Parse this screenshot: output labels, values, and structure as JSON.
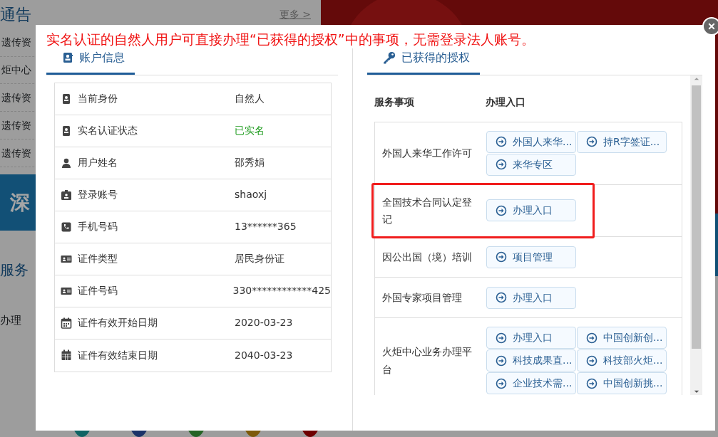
{
  "background": {
    "section_title": "通告",
    "more_link": "更多 >",
    "list_items": [
      "遗传资",
      "炬中心",
      "遗传资",
      "遗传资",
      "遗传资"
    ],
    "banner_text": "深",
    "service_title": "服务",
    "service_item": "办理"
  },
  "dialog": {
    "notice": "实名认证的自然人用户可直接办理“已获得的授权”中的事项，无需登录法人账号。",
    "account_tab": {
      "label": "账户信息",
      "selected": true
    },
    "account_rows": [
      {
        "kind": "id",
        "label": "当前身份",
        "value": "自然人"
      },
      {
        "kind": "id",
        "label": "实名认证状态",
        "value": "已实名",
        "verified": true
      },
      {
        "kind": "user",
        "label": "用户姓名",
        "value": "邵秀娟"
      },
      {
        "kind": "badge",
        "label": "登录账号",
        "value": "shaoxj"
      },
      {
        "kind": "phone",
        "label": "手机号码",
        "value": "13******365"
      },
      {
        "kind": "card",
        "label": "证件类型",
        "value": "居民身份证"
      },
      {
        "kind": "card",
        "label": "证件号码",
        "value": "330************425"
      },
      {
        "kind": "calendar",
        "label": "证件有效开始日期",
        "value": "2020-03-23"
      },
      {
        "kind": "calendar-full",
        "label": "证件有效结束日期",
        "value": "2040-03-23"
      }
    ],
    "auth_tab": {
      "label": "已获得的授权",
      "selected": true
    },
    "auth_columns": [
      "服务事项",
      "办理入口"
    ],
    "auth_rows": [
      {
        "service": "外国人来华工作许可",
        "highlighted": false,
        "entries": [
          "外国人来华...",
          "持R字签证...",
          "来华专区"
        ]
      },
      {
        "service": "全国技术合同认定登记",
        "highlighted": true,
        "entries": [
          "办理入口"
        ]
      },
      {
        "service": "因公出国（境）培训",
        "highlighted": false,
        "entries": [
          "项目管理"
        ]
      },
      {
        "service": "外国专家项目管理",
        "highlighted": false,
        "entries": [
          "办理入口"
        ]
      },
      {
        "service": "火炬中心业务办理平台",
        "highlighted": false,
        "entries": [
          "办理入口",
          "中国创新创...",
          "科技成果直...",
          "科技部火炬...",
          "企业技术需...",
          "中国创新挑..."
        ]
      }
    ]
  }
}
